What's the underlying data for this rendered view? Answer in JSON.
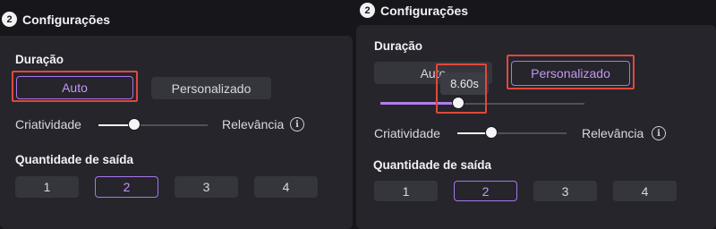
{
  "left": {
    "step_number": "2",
    "title": "Configurações",
    "duration_label": "Duração",
    "auto_label": "Auto",
    "custom_label": "Personalizado",
    "creativity_label": "Criatividade",
    "relevance_label": "Relevância",
    "slider_value": 0.25,
    "output_label": "Quantidade de saída",
    "outputs": [
      "1",
      "2",
      "3",
      "4"
    ],
    "selected_output": "2"
  },
  "right": {
    "step_number": "2",
    "title": "Configurações",
    "duration_label": "Duração",
    "auto_label": "Auto",
    "custom_label": "Personalizado",
    "duration_tooltip": "8.60s",
    "creativity_label": "Criatividade",
    "relevance_label": "Relevância",
    "slider_value": 0.25,
    "output_label": "Quantidade de saída",
    "outputs": [
      "1",
      "2",
      "3",
      "4"
    ],
    "selected_output": "2"
  },
  "colors": {
    "accent": "#a876ec",
    "highlight": "#e0483c"
  },
  "icons": {
    "info": "info-circle-icon"
  }
}
